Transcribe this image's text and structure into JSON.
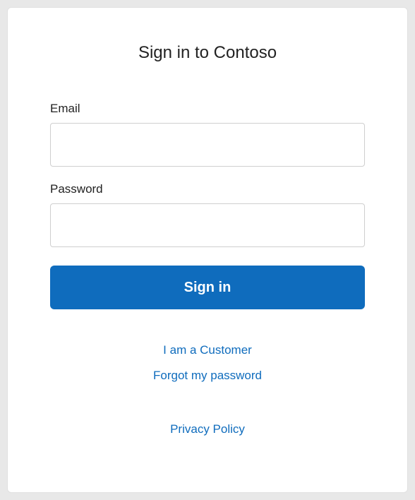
{
  "title": "Sign in to Contoso",
  "email": {
    "label": "Email",
    "value": "",
    "placeholder": ""
  },
  "password": {
    "label": "Password",
    "value": "",
    "placeholder": ""
  },
  "signin_label": "Sign in",
  "links": {
    "customer": "I am a Customer",
    "forgot": "Forgot my password",
    "privacy": "Privacy Policy"
  },
  "colors": {
    "primary": "#0f6cbd",
    "text": "#222222",
    "border": "#cfcfcf"
  }
}
